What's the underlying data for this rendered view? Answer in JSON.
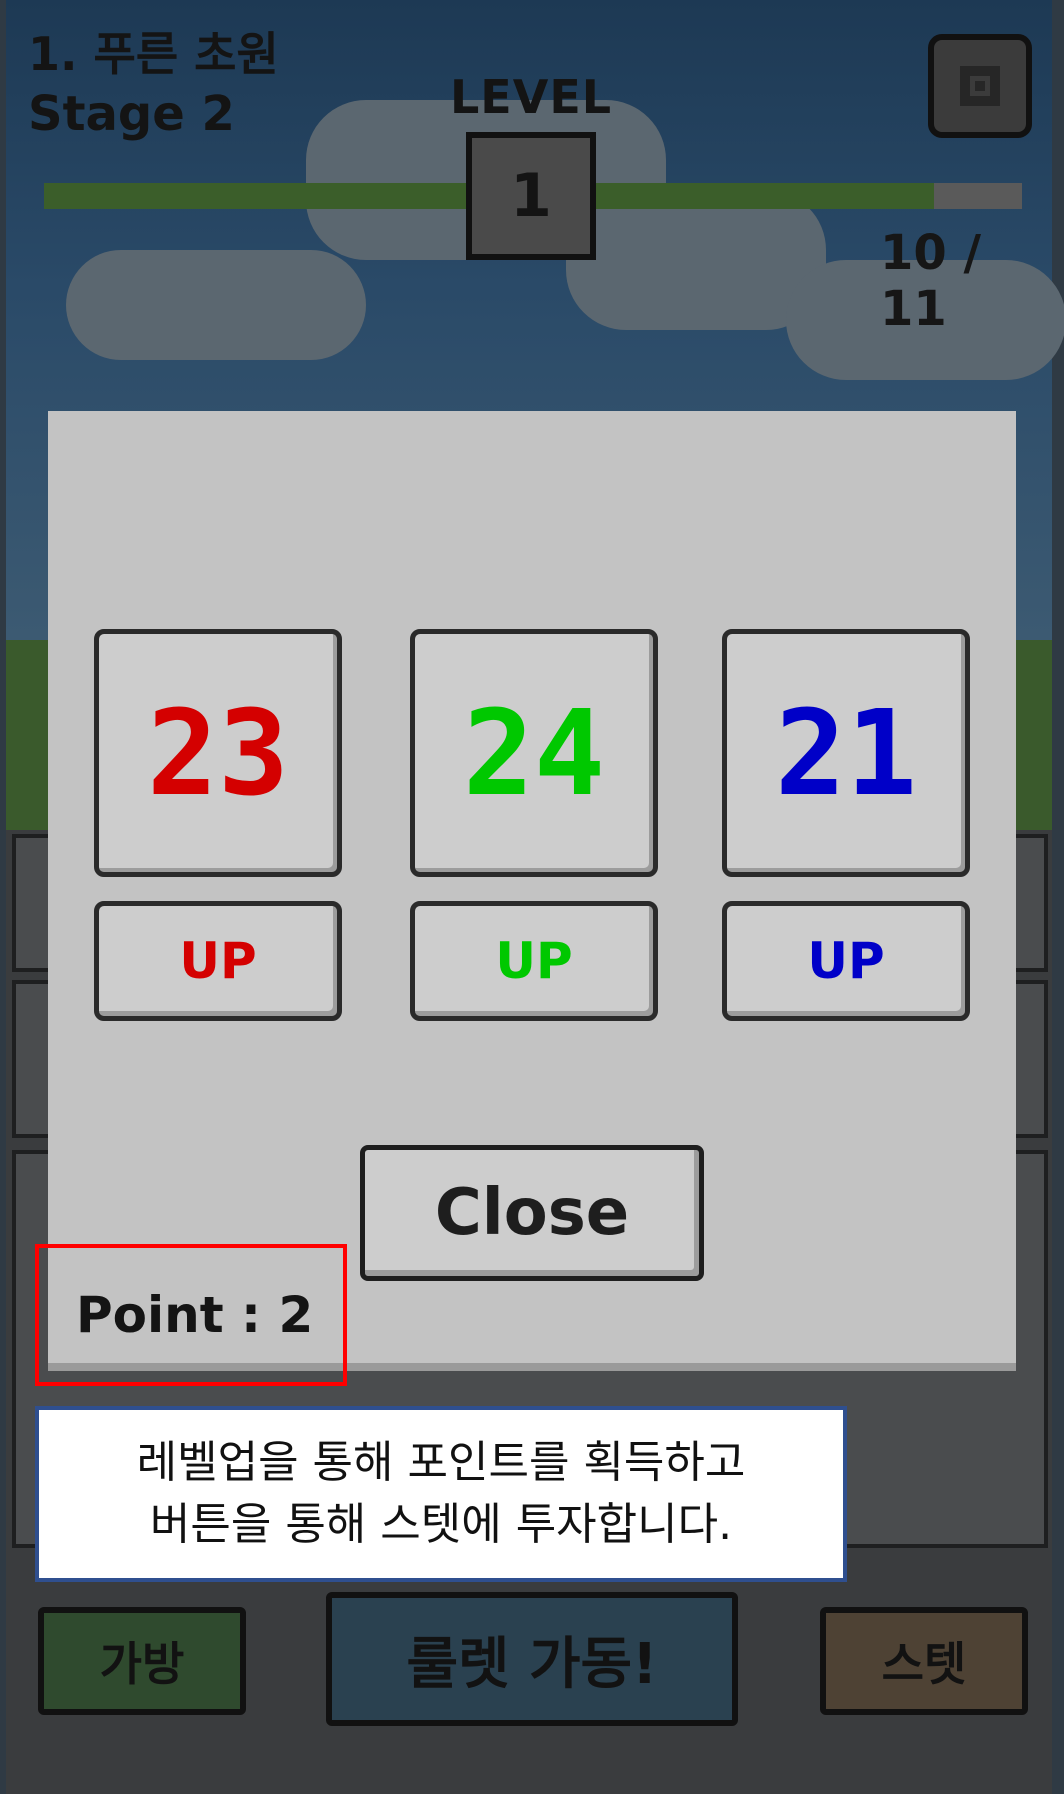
{
  "hud": {
    "stage_name": "1. 푸른 초원",
    "stage_number": "Stage 2",
    "level_label": "LEVEL",
    "level_value": "1",
    "xp_text": "10 / 11",
    "xp_progress": 0.91
  },
  "modal": {
    "stats": [
      {
        "value": "23",
        "color": "#d40000",
        "up_label": "UP"
      },
      {
        "value": "24",
        "color": "#00c800",
        "up_label": "UP"
      },
      {
        "value": "21",
        "color": "#0000c8",
        "up_label": "UP"
      }
    ],
    "close_label": "Close",
    "point_text": "Point : 2"
  },
  "bottom_bar": {
    "bag_label": "가방",
    "roulette_label": "룰렛 가동!",
    "stat_label": "스텟"
  },
  "annotation": {
    "line1": "레벨업을 통해 포인트를 획득하고",
    "line2": "버튼을 통해 스텟에 투자합니다.",
    "highlight_color": "#ff0000",
    "caption_border_color": "#2f4f8f"
  }
}
